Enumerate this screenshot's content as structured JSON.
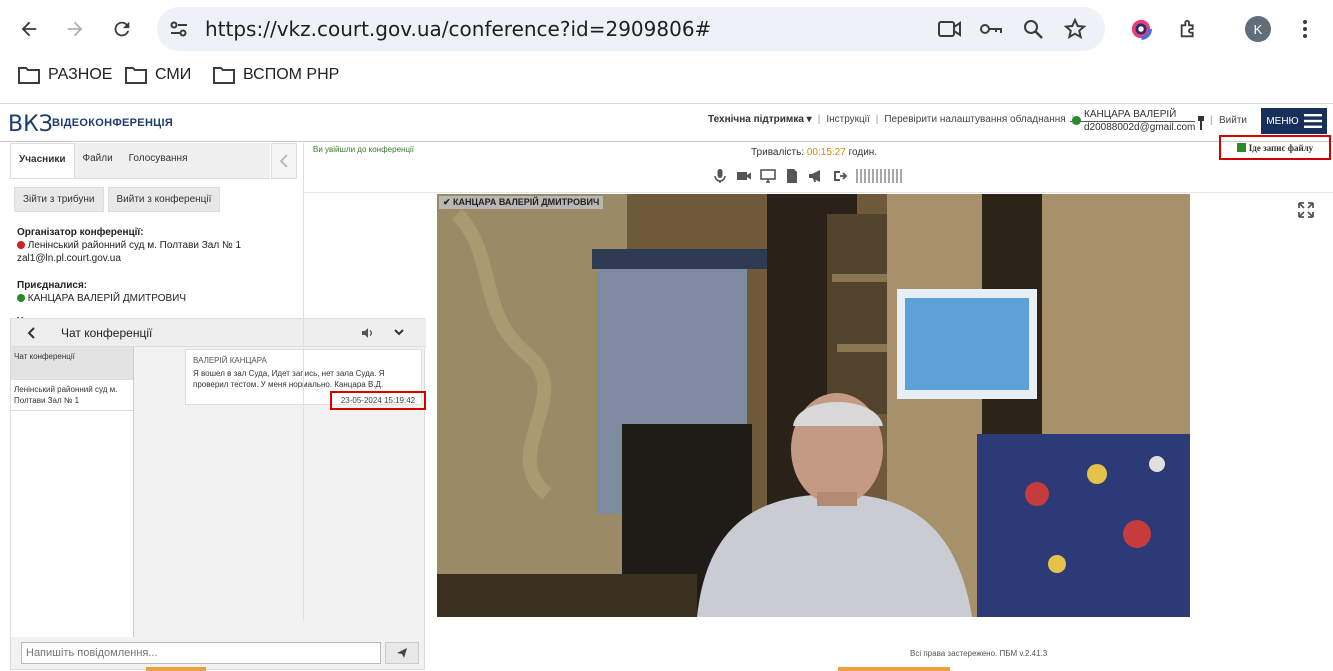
{
  "browser": {
    "url": "https://vkz.court.gov.ua/conference?id=2909806#",
    "profile_initial": "K",
    "bookmarks": [
      {
        "label": "РАЗНОЕ"
      },
      {
        "label": "СМИ"
      },
      {
        "label": "ВСПОМ РНР"
      }
    ]
  },
  "header": {
    "logo": "ВКЗ",
    "logo_sub": "ВІДЕОКОНФЕРЕНЦІЯ",
    "support": "Технічна підтримка",
    "instructions": "Інструкції",
    "check_settings": "Перевірити налаштування обладнання",
    "user_name": "КАНЦАРА ВАЛЕРІЙ",
    "user_email": "d20088002d@gmail.com",
    "logout": "Вийти",
    "menu": "МЕНЮ"
  },
  "left": {
    "tabs": [
      {
        "label": "Учасники",
        "active": true
      },
      {
        "label": "Файли"
      },
      {
        "label": "Голосування"
      }
    ],
    "enter_tribune": "Зійти з трибуни",
    "leave_conf": "Вийти з конференції",
    "organizer_label": "Організатор конференції:",
    "organizer_name": "Ленінський районний суд м. Полтави Зал № 1",
    "organizer_email": "zal1@ln.pl.court.gov.ua",
    "joined_label": "Приєдналися:",
    "joined_name": "КАНЦАРА ВАЛЕРІЙ ДМИТРОВИЧ",
    "participants_label": "Учасники:"
  },
  "chat": {
    "title": "Чат конференції",
    "list": [
      {
        "label": "Чат конференції",
        "selected": true
      },
      {
        "label": "Ленінський районний суд м. Полтави Зал № 1"
      }
    ],
    "message": {
      "author": "ВАЛЕРІЙ КАНЦАРА",
      "text": "Я вошел в зал Суда, Идет запись, нет зала Суда. Я проверил тестом. У меня нормально. Канцара В.Д.",
      "timestamp": "23-05-2024 15:19:42"
    },
    "input_placeholder": "Напишіть повідомлення..."
  },
  "main": {
    "joined_notice": "Ви увійшли до конференції",
    "duration_label": "Тривалість:",
    "duration_value": "00:15:27",
    "duration_unit": "годин.",
    "recording": "Іде запис файлу",
    "video_label": "✔ КАНЦАРА ВАЛЕРІЙ ДМИТРОВИЧ",
    "footer": "Всі права застережено. ПБМ v.2.41.3"
  },
  "colors": {
    "header_navy": "#17305a",
    "online_green": "#2a8a2a",
    "organizer_red": "#d12020",
    "highlight_red": "#d30000"
  }
}
